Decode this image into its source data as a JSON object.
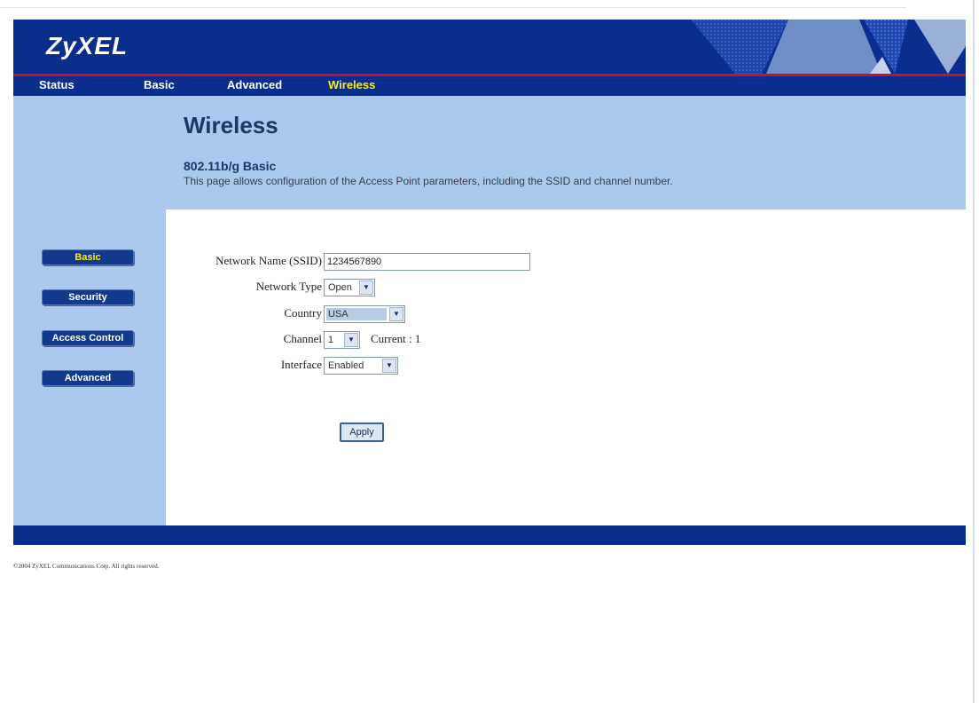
{
  "header": {
    "logo_text": "ZyXEL"
  },
  "nav": {
    "items": [
      {
        "label": "Status"
      },
      {
        "label": "Basic"
      },
      {
        "label": "Advanced"
      },
      {
        "label": "Wireless",
        "active": true
      }
    ]
  },
  "page": {
    "title": "Wireless",
    "subtitle": "802.11b/g Basic",
    "description": "This page allows configuration of the Access Point parameters, including the SSID and channel number."
  },
  "sidebar": {
    "items": [
      {
        "label": "Basic",
        "active": true
      },
      {
        "label": "Security"
      },
      {
        "label": "Access Control"
      },
      {
        "label": "Advanced"
      }
    ]
  },
  "form": {
    "ssid_label": "Network Name (SSID)",
    "ssid_value": "1234567890",
    "network_type_label": "Network Type",
    "network_type_value": "Open",
    "country_label": "Country",
    "country_value": "USA",
    "channel_label": "Channel",
    "channel_value": "1",
    "current_channel_text": "Current : 1",
    "interface_label": "Interface",
    "interface_value": "Enabled",
    "apply_label": "Apply"
  },
  "footer": {
    "copyright": "©2004 ZyXEL Communications Corp.   All rights reserved."
  },
  "colors": {
    "brand_blue": "#0a2e8e",
    "accent_red": "#c8102e",
    "panel_blue": "#a9c9ee",
    "active_text": "#ffee00"
  }
}
